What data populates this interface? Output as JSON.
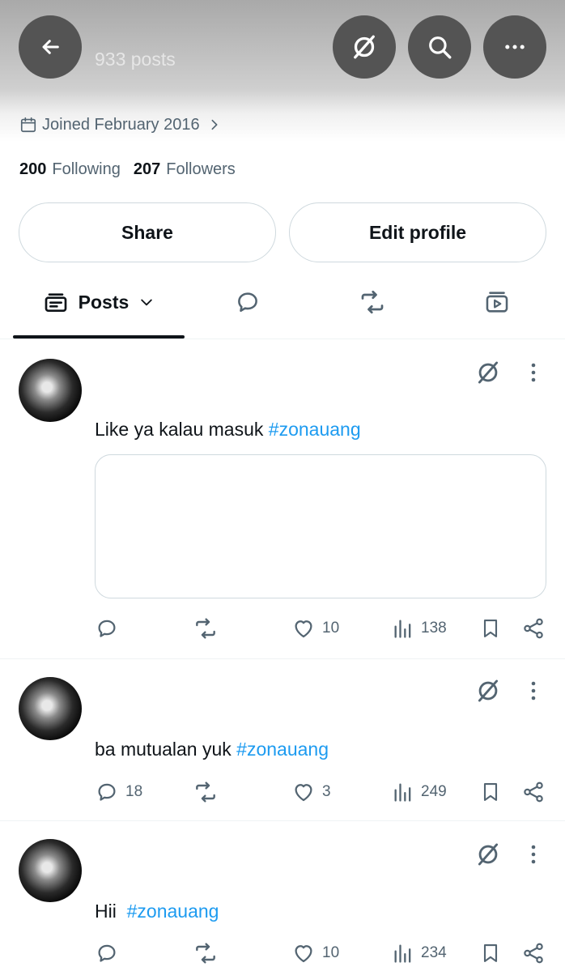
{
  "header": {
    "posts_count": "933 posts",
    "back_icon": "arrow-left-icon",
    "grok_icon": "grok-icon",
    "search_icon": "search-icon",
    "more_icon": "more-horizontal-icon"
  },
  "profile": {
    "joined": "Joined February 2016",
    "following_count": "200",
    "following_label": "Following",
    "followers_count": "207",
    "followers_label": "Followers"
  },
  "buttons": {
    "share": "Share",
    "edit_profile": "Edit profile"
  },
  "tabs": [
    {
      "label": "Posts",
      "icon": "posts-feed-icon",
      "active": true,
      "dropdown_icon": "chevron-down-icon"
    },
    {
      "label": "",
      "icon": "reply-bubble-icon"
    },
    {
      "label": "",
      "icon": "repost-icon"
    },
    {
      "label": "",
      "icon": "media-icon"
    }
  ],
  "posts": [
    {
      "text": "Like ya kalau masuk ",
      "hashtag": "#zonauang",
      "has_media": true,
      "replies": "",
      "reposts": "",
      "likes": "10",
      "views": "138"
    },
    {
      "text": "ba mutualan yuk ",
      "hashtag": "#zonauang",
      "has_media": false,
      "replies": "18",
      "reposts": "",
      "likes": "3",
      "views": "249"
    },
    {
      "text": "Hii  ",
      "hashtag": "#zonauang",
      "has_media": false,
      "replies": "",
      "reposts": "",
      "likes": "10",
      "views": "234"
    }
  ],
  "colors": {
    "accent": "#1d9bf0",
    "text_primary": "#0f1419",
    "text_secondary": "#536471",
    "border": "#cfd9de",
    "header_button_bg": "#545454"
  }
}
